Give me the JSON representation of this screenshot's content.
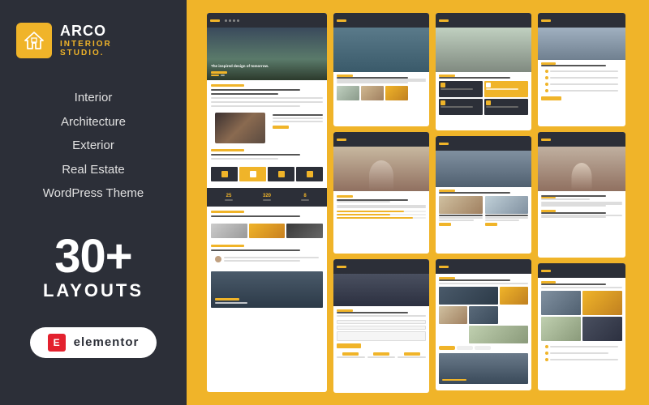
{
  "brand": {
    "name": "ARCO",
    "line1": "INTERIOR",
    "line2": "STUDIO.",
    "icon_label": "house-icon"
  },
  "taglines": [
    {
      "text": "Interior",
      "highlighted": false
    },
    {
      "text": "Architecture",
      "highlighted": false
    },
    {
      "text": "Exterior",
      "highlighted": false
    },
    {
      "text": "Real Estate",
      "highlighted": false
    },
    {
      "text": "WordPress Theme",
      "highlighted": false
    }
  ],
  "layouts": {
    "count": "30+",
    "label": "LAYOUTS"
  },
  "elementor": {
    "badge_text": "elementor",
    "icon_letter": "E"
  },
  "hero_headline": "The inspired design of tomorrow.",
  "colors": {
    "gold": "#f0b429",
    "dark": "#2c2f38",
    "white": "#ffffff"
  }
}
